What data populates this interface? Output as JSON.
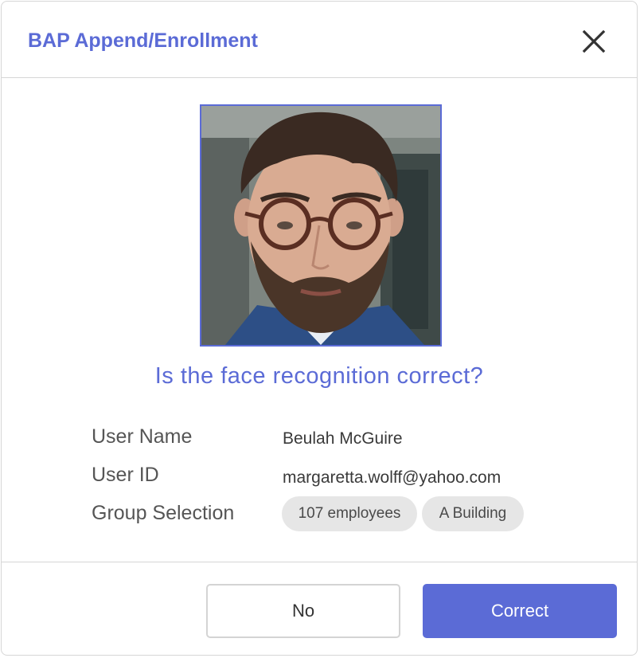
{
  "dialog": {
    "title": "BAP Append/Enrollment",
    "close_icon": "close-icon"
  },
  "photo": {
    "alt": "face-photo"
  },
  "question": "Is the face recognition correct?",
  "info": {
    "user_name_label": "User Name",
    "user_name_value": "Beulah McGuire",
    "user_id_label": "User ID",
    "user_id_value": "margaretta.wolff@yahoo.com",
    "group_label": "Group Selection",
    "groups": [
      "107 employees",
      "A Building"
    ]
  },
  "buttons": {
    "no_label": "No",
    "correct_label": "Correct"
  },
  "colors": {
    "accent": "#5b6bd6",
    "border": "#d6d6d6",
    "chip_bg": "#e6e6e6"
  }
}
